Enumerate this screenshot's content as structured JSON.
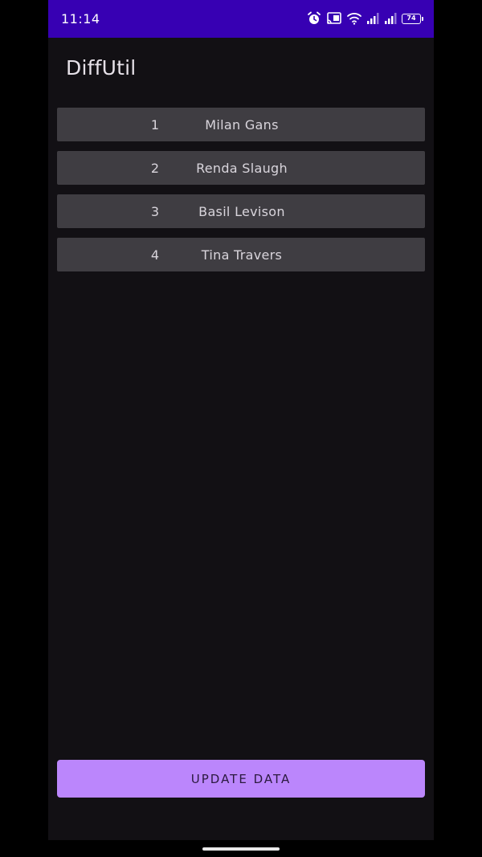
{
  "status_bar": {
    "time": "11:14",
    "battery_level": "74",
    "icons": [
      "alarm-icon",
      "cast-icon",
      "wifi-icon",
      "signal-icon",
      "signal-icon",
      "battery-icon"
    ]
  },
  "app": {
    "title": "DiffUtil"
  },
  "list": {
    "items": [
      {
        "id": "1",
        "name": "Milan Gans"
      },
      {
        "id": "2",
        "name": "Renda Slaugh"
      },
      {
        "id": "3",
        "name": "Basil Levison"
      },
      {
        "id": "4",
        "name": "Tina Travers"
      }
    ]
  },
  "actions": {
    "update_label": "UPDATE DATA"
  },
  "colors": {
    "status_bar": "#3700b3",
    "background": "#121014",
    "list_item": "#3f3d42",
    "accent_button": "#bb86fc"
  }
}
